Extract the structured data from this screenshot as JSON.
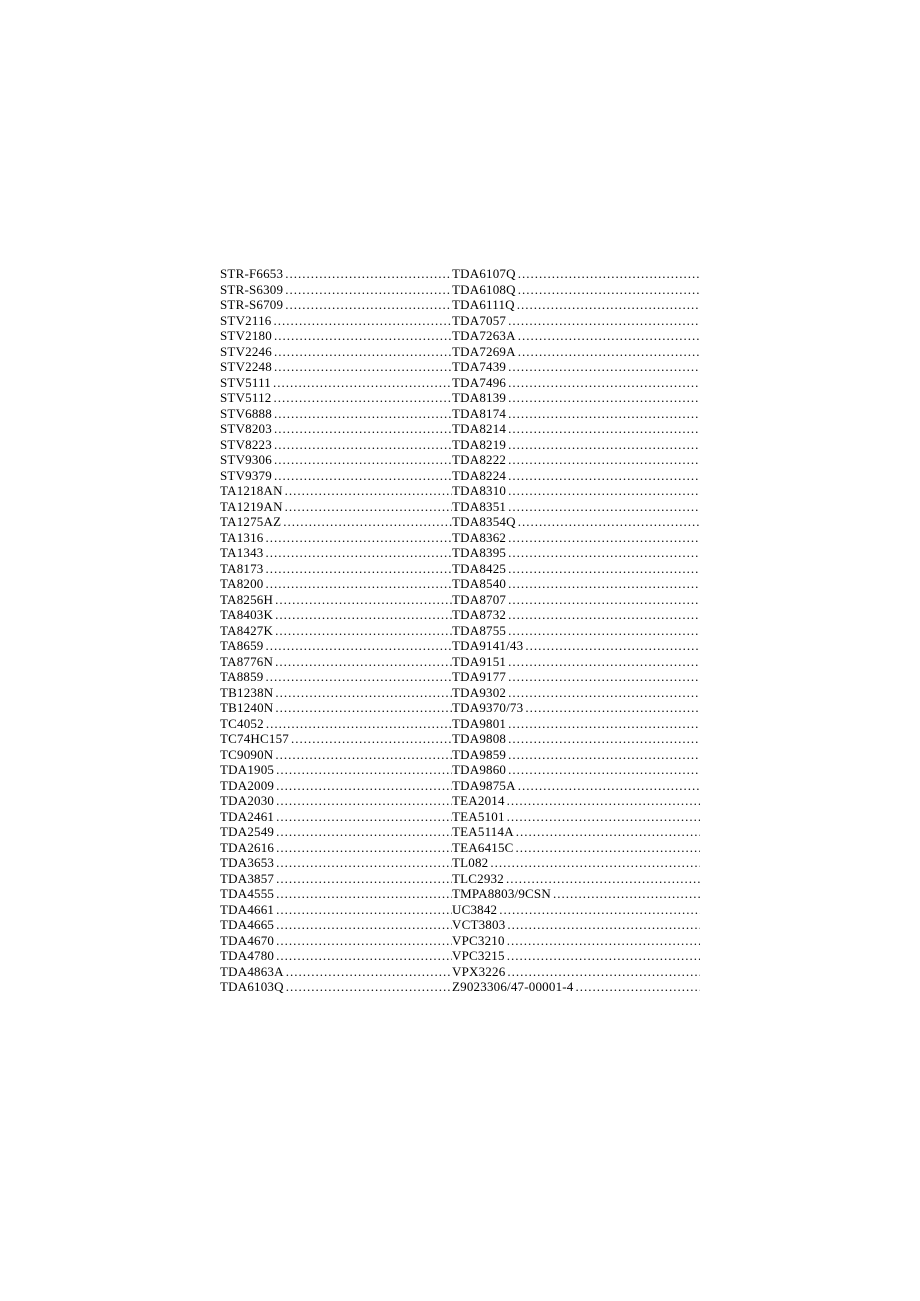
{
  "columns": {
    "left": [
      "STR-F6653",
      "STR-S6309",
      "STR-S6709",
      "STV2116",
      "STV2180",
      "STV2246",
      "STV2248",
      "STV5111",
      "STV5112",
      "STV6888",
      "STV8203",
      "STV8223",
      "STV9306",
      "STV9379",
      "TA1218AN",
      "TA1219AN",
      "TA1275AZ",
      "TA1316",
      "TA1343",
      "TA8173",
      "TA8200",
      "TA8256H",
      "TA8403K",
      "TA8427K",
      "TA8659",
      "TA8776N",
      "TA8859",
      "TB1238N",
      "TB1240N",
      "TC4052",
      "TC74HC157",
      "TC9090N",
      "TDA1905",
      "TDA2009",
      "TDA2030",
      "TDA2461",
      "TDA2549",
      "TDA2616",
      "TDA3653",
      "TDA3857",
      "TDA4555",
      "TDA4661",
      "TDA4665",
      "TDA4670",
      "TDA4780",
      "TDA4863A",
      "TDA6103Q"
    ],
    "right": [
      "TDA6107Q",
      "TDA6108Q",
      "TDA6111Q",
      "TDA7057",
      "TDA7263A",
      "TDA7269A",
      "TDA7439",
      "TDA7496",
      "TDA8139",
      "TDA8174",
      "TDA8214",
      "TDA8219",
      "TDA8222",
      "TDA8224",
      "TDA8310",
      "TDA8351",
      "TDA8354Q",
      "TDA8362",
      "TDA8395",
      "TDA8425",
      "TDA8540",
      "TDA8707",
      "TDA8732",
      "TDA8755",
      "TDA9141/43",
      "TDA9151",
      "TDA9177",
      "TDA9302",
      "TDA9370/73",
      "TDA9801",
      "TDA9808",
      "TDA9859",
      "TDA9860",
      "TDA9875A",
      "TEA2014",
      "TEA5101",
      "TEA5114A",
      "TEA6415C",
      "TL082",
      "TLC2932",
      "TMPA8803/9CSN",
      "UC3842",
      "VCT3803",
      "VPC3210",
      "VPC3215",
      "VPX3226",
      "Z9023306/47-00001-4"
    ]
  }
}
